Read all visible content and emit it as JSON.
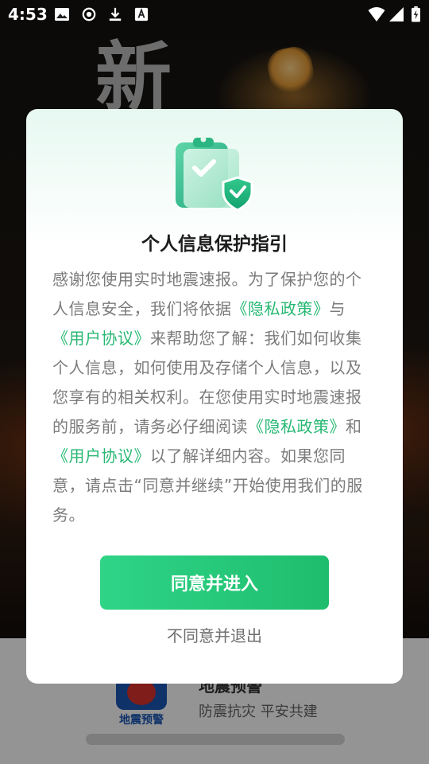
{
  "status_bar": {
    "time": "4:53",
    "left_icons": [
      "image-icon",
      "record-icon",
      "download-icon",
      "font-a-icon"
    ],
    "right_icons": [
      "wifi-icon",
      "cellular-signal-icon",
      "battery-charging-icon"
    ]
  },
  "background": {
    "splash_title": "新",
    "brand": {
      "logo_text": "地震预警",
      "name": "地震预警",
      "slogan": "防震抗灾 平安共建"
    }
  },
  "dialog": {
    "title": "个人信息保护指引",
    "body": {
      "p1": "感谢您使用实时地震速报。为了保护您的个人信息安全，我们将依据",
      "link_privacy_1": "《隐私政策》",
      "p2": "与",
      "link_agreement_1": "《用户协议》",
      "p3": "来帮助您了解：我们如何收集个人信息，如何使用及存储个人信息，以及您享有的相关权利。在您使用实时地震速报的服务前，请务必仔细阅读",
      "link_privacy_2": "《隐私政策》",
      "p4": "和",
      "link_agreement_2": "《用户协议》",
      "p5": "以了解详细内容。如果您同意，请点击“同意并继续”开始使用我们的服务。"
    },
    "agree_label": "同意并进入",
    "disagree_label": "不同意并退出"
  },
  "colors": {
    "accent_green": "#27b873",
    "button_gradient_start": "#2fd487",
    "button_gradient_end": "#1ebd6d",
    "body_text": "#7b7b7b"
  }
}
